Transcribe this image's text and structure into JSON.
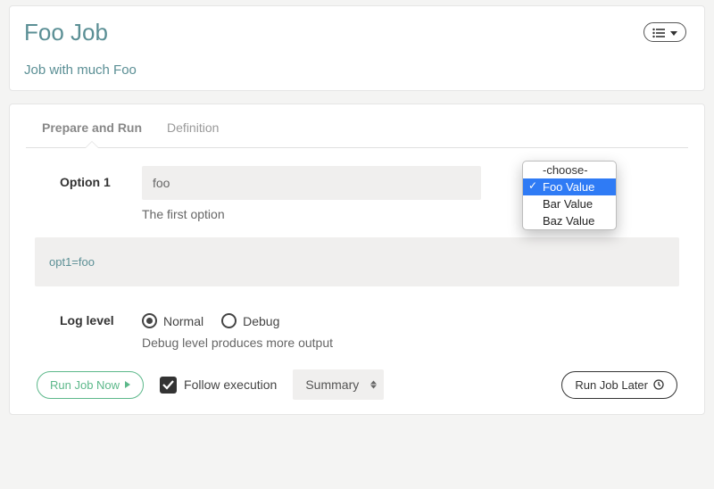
{
  "header": {
    "title": "Foo Job",
    "description": "Job with much Foo"
  },
  "tabs": [
    {
      "label": "Prepare and Run",
      "active": true
    },
    {
      "label": "Definition",
      "active": false
    }
  ],
  "option1": {
    "label": "Option 1",
    "value": "foo",
    "help": "The first option",
    "dropdown": {
      "placeholder": "-choose-",
      "items": [
        "Foo Value",
        "Bar Value",
        "Baz Value"
      ],
      "selected": "Foo Value"
    }
  },
  "code_preview": "opt1=foo",
  "log_level": {
    "label": "Log level",
    "options": [
      {
        "label": "Normal",
        "checked": true
      },
      {
        "label": "Debug",
        "checked": false
      }
    ],
    "help": "Debug level produces more output"
  },
  "footer": {
    "run_now": "Run Job Now",
    "follow_label": "Follow execution",
    "follow_checked": true,
    "view_select": "Summary",
    "run_later": "Run Job Later"
  }
}
